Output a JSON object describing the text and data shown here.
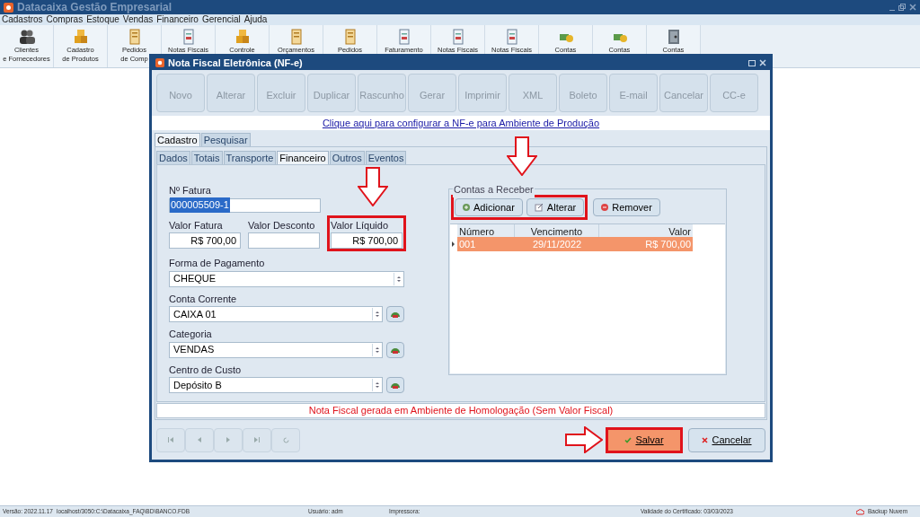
{
  "app": {
    "title": "Datacaixa Gestão Empresarial"
  },
  "menu": [
    "Cadastros",
    "Compras",
    "Estoque",
    "Vendas",
    "Financeiro",
    "Gerencial",
    "Ajuda"
  ],
  "toolbar": [
    {
      "lines": [
        "Clientes",
        "e Fornecedores"
      ],
      "kind": "people"
    },
    {
      "lines": [
        "Cadastro",
        "de Produtos"
      ],
      "kind": "boxes"
    },
    {
      "lines": [
        "Pedidos",
        "de Comp"
      ],
      "kind": "clipboard"
    },
    {
      "lines": [
        "Notas Fiscais"
      ],
      "kind": "document"
    },
    {
      "lines": [
        "Controle"
      ],
      "kind": "boxes"
    },
    {
      "lines": [
        "Orçamentos"
      ],
      "kind": "clipboard"
    },
    {
      "lines": [
        "Pedidos"
      ],
      "kind": "clipboard"
    },
    {
      "lines": [
        "Faturamento"
      ],
      "kind": "document"
    },
    {
      "lines": [
        "Notas Fiscais"
      ],
      "kind": "document"
    },
    {
      "lines": [
        "Notas Fiscais"
      ],
      "kind": "document"
    },
    {
      "lines": [
        "Contas"
      ],
      "kind": "money"
    },
    {
      "lines": [
        "Contas"
      ],
      "kind": "money"
    },
    {
      "lines": [
        "Contas"
      ],
      "kind": "safe"
    }
  ],
  "dialog": {
    "title": "Nota Fiscal Eletrônica (NF-e)",
    "actions": [
      {
        "label": "Novo",
        "disabled": true
      },
      {
        "label": "Alterar",
        "disabled": true
      },
      {
        "label": "Excluir",
        "disabled": true
      },
      {
        "label": "Duplicar",
        "disabled": true
      },
      {
        "label": "Rascunho",
        "disabled": true
      },
      {
        "label": "Gerar",
        "disabled": true
      },
      {
        "label": "Imprimir",
        "disabled": true
      },
      {
        "label": "XML",
        "disabled": true
      },
      {
        "label": "Boleto",
        "disabled": true
      },
      {
        "label": "E-mail",
        "disabled": true
      },
      {
        "label": "Cancelar",
        "disabled": true
      },
      {
        "label": "CC-e",
        "disabled": true
      }
    ],
    "config_link": "Clique aqui para configurar a NF-e para Ambiente de Produção",
    "tabs": [
      {
        "label": "Cadastro",
        "selected": true
      },
      {
        "label": "Pesquisar",
        "selected": false
      }
    ],
    "subtabs": [
      {
        "label": "Dados",
        "selected": false
      },
      {
        "label": "Totais",
        "selected": false
      },
      {
        "label": "Transporte",
        "selected": false
      },
      {
        "label": "Financeiro",
        "selected": true
      },
      {
        "label": "Outros",
        "selected": false
      },
      {
        "label": "Eventos",
        "selected": false
      }
    ],
    "form": {
      "fatura": {
        "label": "Nº Fatura",
        "value": "000005509-1"
      },
      "valor_fatura": {
        "label": "Valor Fatura",
        "value": "R$ 700,00"
      },
      "valor_desconto": {
        "label": "Valor Desconto"
      },
      "valor_liquido": {
        "label": "Valor Líquido",
        "value": "R$ 700,00"
      },
      "selects": [
        {
          "label": "Forma de Pagamento",
          "value": "CHEQUE",
          "lookup": false
        },
        {
          "label": "Conta Corrente",
          "value": "CAIXA 01",
          "lookup": true
        },
        {
          "label": "Categoria",
          "value": "VENDAS",
          "lookup": true
        },
        {
          "label": "Centro de Custo",
          "value": "Depósito B",
          "lookup": true
        }
      ]
    },
    "receivables": {
      "title": "Contas a Receber",
      "buttons": [
        {
          "label": "Adicionar",
          "kind": "add"
        },
        {
          "label": "Alterar",
          "kind": "edit"
        },
        {
          "label": "Remover",
          "kind": "remove"
        }
      ],
      "columns": [
        "Número",
        "Vencimento",
        "Valor"
      ],
      "rows": [
        {
          "numero": "001",
          "vencimento": "29/11/2022",
          "valor": "R$ 700,00",
          "selected": true
        }
      ]
    },
    "message": "Nota Fiscal gerada em Ambiente de Homologação (Sem Valor Fiscal)",
    "save": "Salvar",
    "cancel": "Cancelar"
  },
  "status_bar": {
    "version": "Versão: 2022.11.17",
    "database": "localhost/3050:C:\\Datacaixa_FAQ\\BD\\BANCO.FDB",
    "user": "Usuário: adm",
    "printer": "Impressora:",
    "certificate": "Validade do Certificado: 03/03/2023",
    "backup": "Backup Nuvem"
  }
}
